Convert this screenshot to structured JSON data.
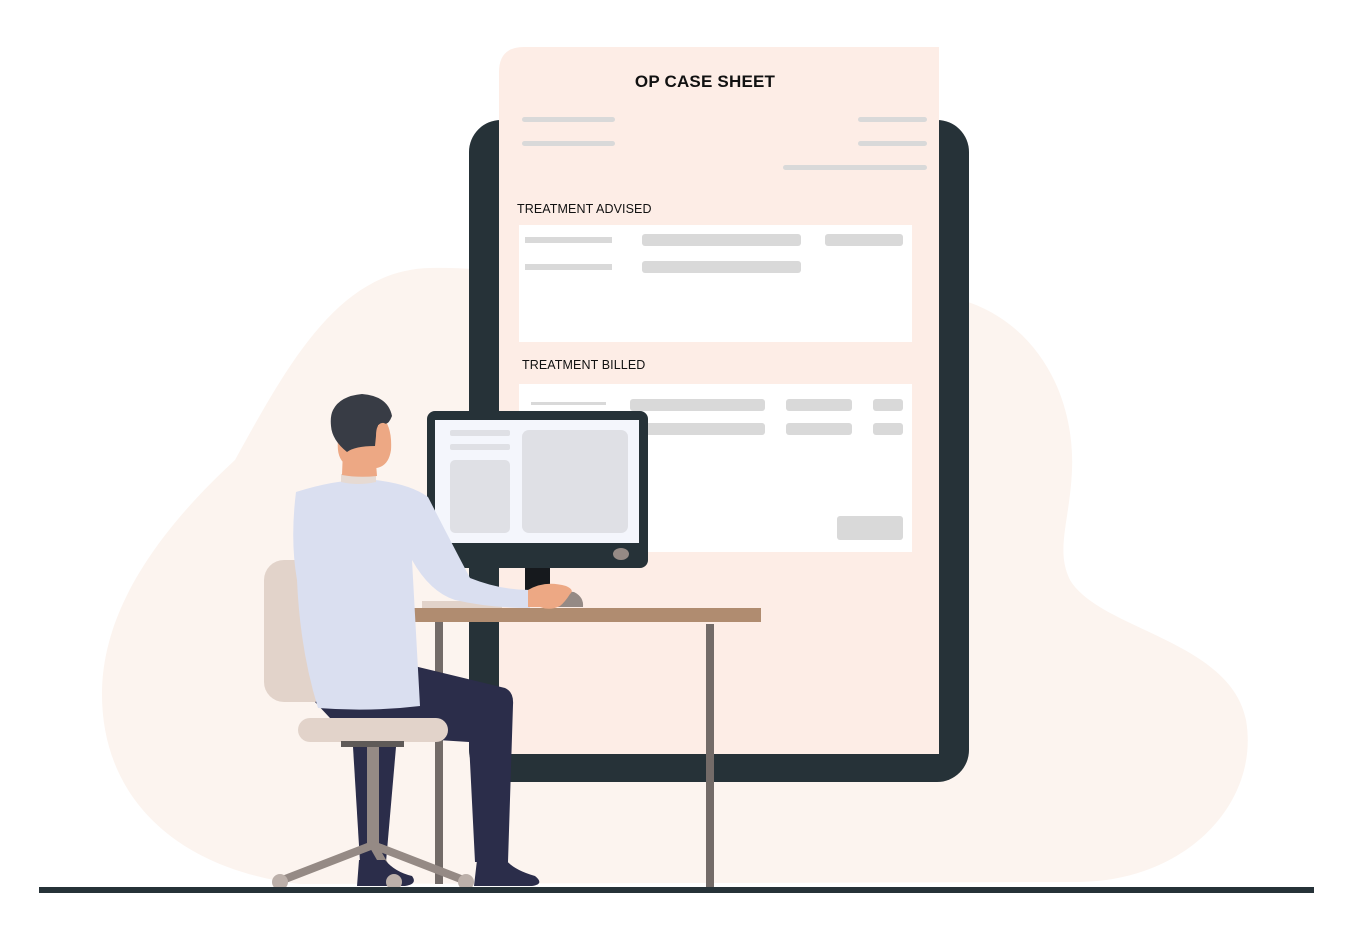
{
  "case_sheet": {
    "title": "OP CASE SHEET",
    "sections": [
      {
        "label": "TREATMENT ADVISED",
        "rows": 2
      },
      {
        "label": "TREATMENT BILLED",
        "rows": 2
      }
    ]
  },
  "colors": {
    "background": "#ffffff",
    "blob": "#fcf4ef",
    "sheet": "#fdede6",
    "tablet_frame": "#263238",
    "placeholder": "#d9d9d9",
    "shirt": "#dadff0",
    "pants": "#2b2d4a",
    "hair": "#383c45",
    "skin": "#eda884",
    "chair": "#e2d3ca",
    "chair_base": "#958a85",
    "desk_top": "#b08c70",
    "desk_leg": "#736b68",
    "monitor_screen": "#f4f6fc",
    "monitor_panel": "#dfe0e5",
    "floor": "#263238"
  },
  "icons": {
    "scene": "doctor-at-computer-illustration"
  }
}
